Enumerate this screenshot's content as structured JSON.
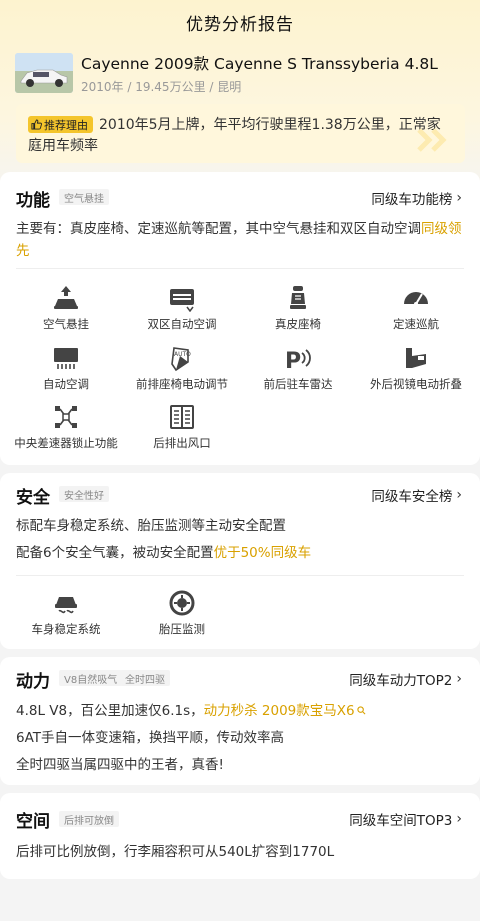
{
  "header": {
    "title": "优势分析报告"
  },
  "car": {
    "title": "Cayenne 2009款 Cayenne S Transsyberia 4.8L",
    "subtitle": "2010年 / 19.45万公里 / 昆明"
  },
  "reason": {
    "badge": "推荐理由",
    "text": "2010年5月上牌，年平均行驶里程1.38万公里，正常家庭用车频率"
  },
  "features": {
    "title": "功能",
    "tag": "空气悬挂",
    "link": "同级车功能榜",
    "desc_plain": "主要有：真皮座椅、定速巡航等配置，其中空气悬挂和双区自动空调",
    "desc_highlight": "同级领先",
    "items": [
      {
        "label": "空气悬挂",
        "icon": "air-suspension-icon"
      },
      {
        "label": "双区自动空调",
        "icon": "dual-zone-ac-icon"
      },
      {
        "label": "真皮座椅",
        "icon": "leather-seat-icon"
      },
      {
        "label": "定速巡航",
        "icon": "cruise-control-icon"
      },
      {
        "label": "自动空调",
        "icon": "auto-ac-icon"
      },
      {
        "label": "前排座椅电动调节",
        "icon": "power-seat-icon"
      },
      {
        "label": "前后驻车雷达",
        "icon": "parking-radar-icon"
      },
      {
        "label": "外后视镜电动折叠",
        "icon": "mirror-fold-icon"
      },
      {
        "label": "中央差速器锁止功能",
        "icon": "diff-lock-icon"
      },
      {
        "label": "后排出风口",
        "icon": "rear-vent-icon"
      }
    ]
  },
  "safety": {
    "title": "安全",
    "tag": "安全性好",
    "link": "同级车安全榜",
    "line1": "标配车身稳定系统、胎压监测等主动安全配置",
    "line2_plain": "配备6个安全气囊，被动安全配置",
    "line2_highlight": "优于50%同级车",
    "items": [
      {
        "label": "车身稳定系统",
        "icon": "stability-control-icon"
      },
      {
        "label": "胎压监测",
        "icon": "tire-pressure-icon"
      }
    ]
  },
  "power": {
    "title": "动力",
    "tags": [
      "V8自然吸气",
      "全时四驱"
    ],
    "link": "同级车动力TOP2",
    "line1_plain": "4.8L V8，百公里加速仅6.1s，",
    "line1_highlight": "动力秒杀  2009款宝马X6",
    "line2": "6AT手自一体变速箱，换挡平顺，传动效率高",
    "line3": "全时四驱当属四驱中的王者，真香!"
  },
  "space": {
    "title": "空间",
    "tag": "后排可放倒",
    "link": "同级车空间TOP3",
    "line1": "后排可比例放倒，行李厢容积可从540L扩容到1770L"
  },
  "colors": {
    "accent": "#d9a100",
    "badge": "#f4c52c"
  }
}
